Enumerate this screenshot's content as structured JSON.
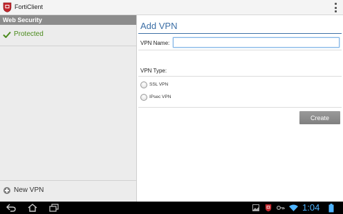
{
  "app": {
    "title": "FortiClient",
    "icon": "forticlient-logo-icon"
  },
  "sidebar": {
    "section_header": "Web Security",
    "status": {
      "label": "Protected",
      "icon": "checkmark-icon",
      "color": "#4a8a1c"
    },
    "new_vpn": {
      "label": "New VPN",
      "icon": "plus-circle-icon"
    }
  },
  "form": {
    "title": "Add VPN",
    "name_label": "VPN Name:",
    "name_value": "",
    "type_label": "VPN Type:",
    "type_options": [
      {
        "label": "SSL VPN",
        "selected": false
      },
      {
        "label": "IPsec VPN",
        "selected": false
      }
    ],
    "create_button": "Create",
    "accent_color": "#3b6ea5"
  },
  "system_bar": {
    "time": "1:04",
    "nav_icons": [
      "back-icon",
      "home-icon",
      "recent-apps-icon"
    ],
    "status_icons": [
      "image-notification-icon",
      "forticlient-notification-icon",
      "key-icon",
      "wifi-icon",
      "battery-icon"
    ]
  }
}
